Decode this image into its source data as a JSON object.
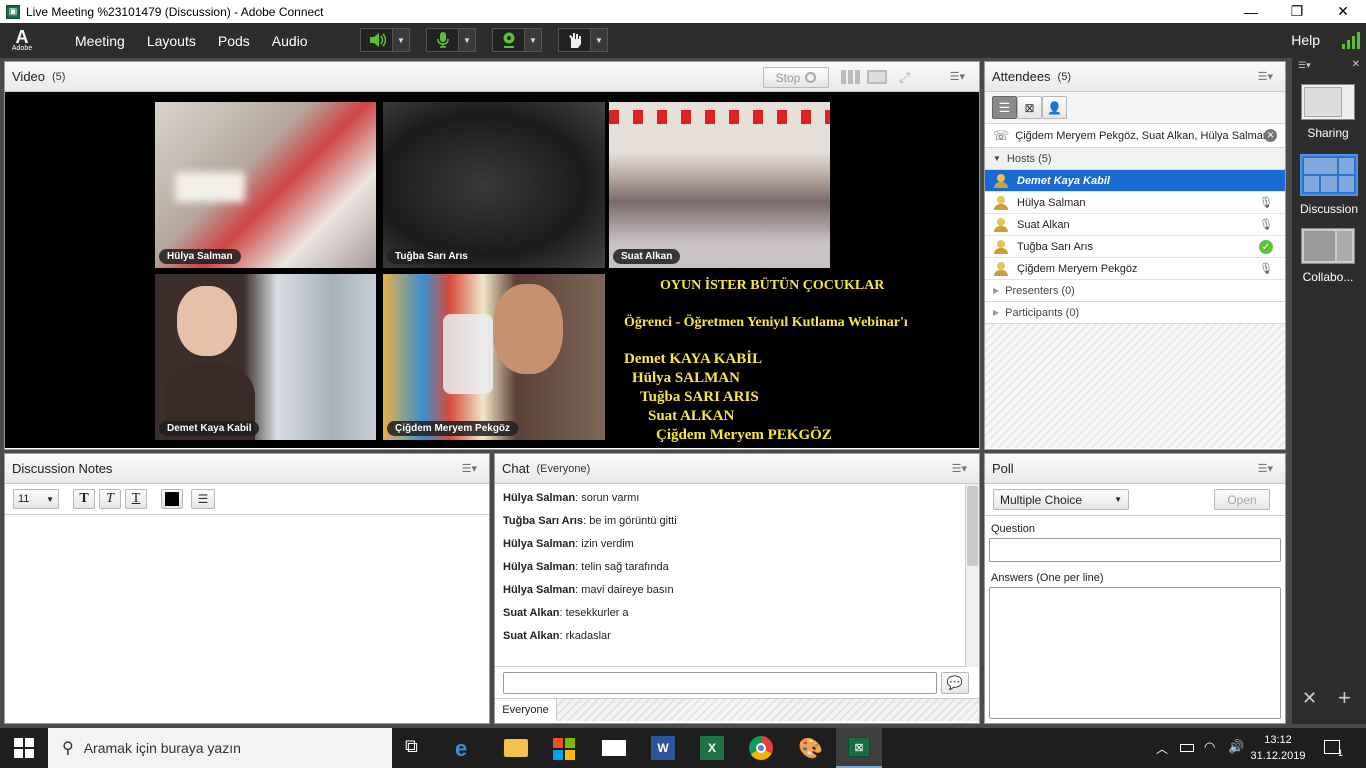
{
  "window": {
    "title": "Live Meeting %23101479 (Discussion) - Adobe Connect",
    "minimize": "—",
    "restore": "❐",
    "close": "✕"
  },
  "menubar": {
    "logo_text": "Adobe",
    "items": [
      "Meeting",
      "Layouts",
      "Pods",
      "Audio"
    ],
    "help": "Help"
  },
  "video_pod": {
    "title": "Video",
    "count": "(5)",
    "stop_label": "Stop",
    "tiles": [
      {
        "name": "Hülya Salman"
      },
      {
        "name": "Tuğba Sarı Arıs"
      },
      {
        "name": "Suat Alkan"
      },
      {
        "name": "Demet Kaya Kabil"
      },
      {
        "name": "Çiğdem Meryem Pekgöz"
      }
    ],
    "overlay": {
      "line1": "OYUN İSTER BÜTÜN ÇOCUKLAR",
      "line2": "Öğrenci - Öğretmen Yeniyıl Kutlama Webinar'ı",
      "names": [
        "Demet KAYA KABİL",
        "Hülya SALMAN",
        "Tuğba SARI ARIS",
        "Suat ALKAN",
        "Çiğdem Meryem PEKGÖZ"
      ]
    }
  },
  "attendees": {
    "title": "Attendees",
    "count": "(5)",
    "speaking": "Çiğdem Meryem Pekgöz, Suat Alkan, Hülya Salman",
    "hosts_label": "Hosts (5)",
    "hosts": [
      {
        "name": "Demet Kaya Kabil",
        "selected": true
      },
      {
        "name": "Hülya Salman"
      },
      {
        "name": "Suat Alkan"
      },
      {
        "name": "Tuğba Sarı Arıs"
      },
      {
        "name": "Çiğdem Meryem Pekgöz"
      }
    ],
    "presenters_label": "Presenters (0)",
    "participants_label": "Participants (0)"
  },
  "notes": {
    "title": "Discussion Notes",
    "font_size": "11"
  },
  "chat": {
    "title": "Chat",
    "audience": "(Everyone)",
    "messages": [
      {
        "sender": "Hülya Salman",
        "text": "sorun varmı"
      },
      {
        "sender": "Tuğba Sarı Arıs",
        "text": "be im görüntü gitti"
      },
      {
        "sender": "Hülya Salman",
        "text": "izin verdim"
      },
      {
        "sender": "Hülya Salman",
        "text": "telin sağ tarafında"
      },
      {
        "sender": "Hülya Salman",
        "text": "mavi daireye basın"
      },
      {
        "sender": "Suat Alkan",
        "text": "tesekkurler  a"
      },
      {
        "sender": "Suat Alkan",
        "text": "rkadaslar"
      }
    ],
    "tab": "Everyone"
  },
  "poll": {
    "title": "Poll",
    "type": "Multiple Choice",
    "open": "Open",
    "question_label": "Question",
    "answers_label": "Answers (One per line)"
  },
  "layouts": {
    "items": [
      "Sharing",
      "Discussion",
      "Collabo..."
    ]
  },
  "taskbar": {
    "search_placeholder": "Aramak için buraya yazın",
    "time": "13:12",
    "date": "31.12.2019",
    "notif": "1"
  },
  "colors": {
    "chrome_dark": "#2d2d2d",
    "selected_blue": "#1a6ad3",
    "overlay_yellow": "#f6e645",
    "mic_green": "#5bc236"
  }
}
